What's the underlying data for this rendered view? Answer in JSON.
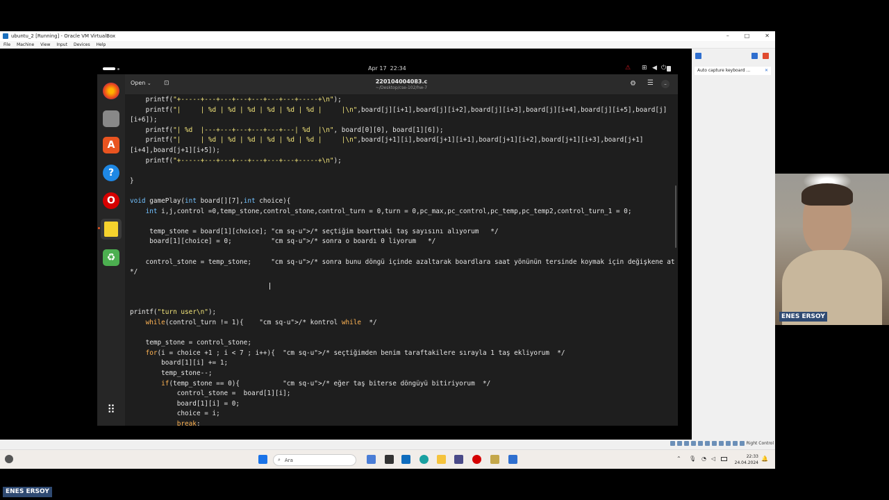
{
  "host": {
    "window_title": "ubuntu_2 [Running] - Oracle VM VirtualBox",
    "menu": [
      "File",
      "Machine",
      "View",
      "Input",
      "Devices",
      "Help"
    ],
    "auto_capture_label": "Auto capture keyboard ...",
    "status_right": "Right Control"
  },
  "taskbar": {
    "search_placeholder": "Ara",
    "time": "22:33",
    "date": "24.04.2024"
  },
  "guest": {
    "clock": "Apr 17  22:34",
    "editor": {
      "open_label": "Open",
      "file_name": "220104004083.c",
      "file_path": "~/Desktop/cse-102/hw-7"
    }
  },
  "code_lines": [
    "    printf(\"+-----+---+---+---+---+---+---+-----+\\n\");",
    "    printf(\"|     | %d | %d | %d | %d | %d | %d |     |\\n\",board[j][i+1],board[j][i+2],board[j][i+3],board[j][i+4],board[j][i+5],board[j]",
    "[i+6]);",
    "    printf(\"| %d  |---+---+---+---+---+---| %d  |\\n\", board[0][0], board[1][6]);",
    "    printf(\"|     | %d | %d | %d | %d | %d | %d |     |\\n\",board[j+1][i],board[j+1][i+1],board[j+1][i+2],board[j+1][i+3],board[j+1]",
    "[i+4],board[j+1][i+5]);",
    "    printf(\"+-----+---+---+---+---+---+---+-----+\\n\");",
    "",
    "}",
    "",
    "void gamePlay(int board[][7],int choice){",
    "    int i,j,control =0,temp_stone,control_stone,control_turn = 0,turn = 0,pc_max,pc_control,pc_temp,pc_temp2,control_turn_1 = 0;",
    "",
    "     temp_stone = board[1][choice]; /* seçtiğim boarttaki taş sayısını alıyorum   */",
    "     board[1][choice] = 0;          /* sonra o boardı 0 liyorum   */",
    "",
    "    control_stone = temp_stone;     /* sonra bunu döngü içinde azaltarak boardlara saat yönünün tersinde koymak için değişkene atıorum",
    "*/",
    "",
    "",
    "",
    "printf(\"turn user\\n\");",
    "    while(control_turn != 1){    /* kontrol while  */",
    "",
    "    temp_stone = control_stone;",
    "    for(i = choice +1 ; i < 7 ; i++){  /* seçtiğimden benim taraftakilere sırayla 1 taş ekliyorum  */",
    "        board[1][i] += 1;",
    "        temp_stone--;",
    "        if(temp_stone == 0){           /* eğer taş biterse döngüyü bitiriyorum  */",
    "            control_stone =  board[1][i];",
    "            board[1][i] = 0;",
    "            choice = i;",
    "            break;"
  ],
  "overlays": {
    "webcam_name": "ENES ERSOY",
    "bottom_name": "ENES ERSOY"
  },
  "colors": {
    "editor_bg": "#1e1e1e",
    "keyword": "#ffb454",
    "string": "#f3e57a",
    "comment": "#b06f6f",
    "name_tag": "#2f4a72"
  }
}
